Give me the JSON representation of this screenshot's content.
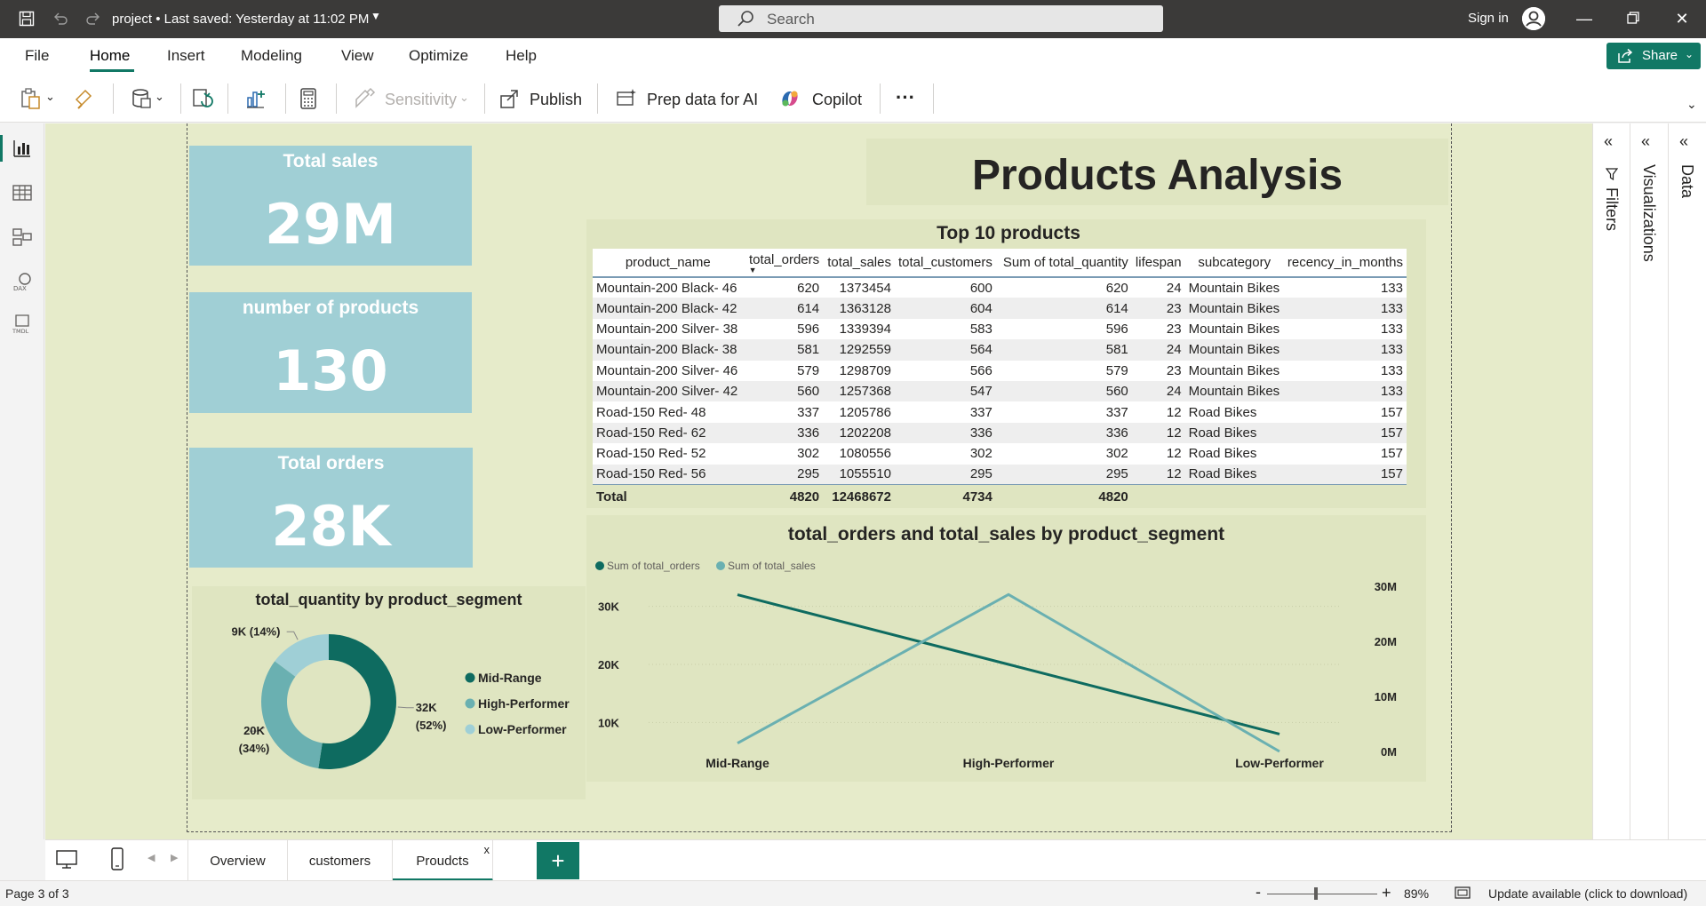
{
  "titlebar": {
    "file_title": "project • Last saved: Yesterday at 11:02 PM",
    "search_placeholder": "Search",
    "sign_in": "Sign in"
  },
  "menu": {
    "items": [
      "File",
      "Home",
      "Insert",
      "Modeling",
      "View",
      "Optimize",
      "Help"
    ],
    "active": "Home",
    "share": "Share"
  },
  "toolbar": {
    "sensitivity": "Sensitivity",
    "publish": "Publish",
    "prep_data": "Prep data for AI",
    "copilot": "Copilot",
    "more": "···"
  },
  "cards": {
    "total_sales": {
      "title": "Total sales",
      "value": "29M"
    },
    "num_products": {
      "title": "number of products",
      "value": "130"
    },
    "total_orders": {
      "title": "Total orders",
      "value": "28K"
    }
  },
  "report_title": "Products Analysis",
  "table": {
    "title": "Top 10 products",
    "columns": [
      "product_name",
      "total_orders",
      "total_sales",
      "total_customers",
      "Sum of total_quantity",
      "lifespan",
      "subcategory",
      "recency_in_months"
    ],
    "rows": [
      [
        "Mountain-200 Black- 46",
        "620",
        "1373454",
        "600",
        "620",
        "24",
        "Mountain Bikes",
        "133"
      ],
      [
        "Mountain-200 Black- 42",
        "614",
        "1363128",
        "604",
        "614",
        "23",
        "Mountain Bikes",
        "133"
      ],
      [
        "Mountain-200 Silver- 38",
        "596",
        "1339394",
        "583",
        "596",
        "23",
        "Mountain Bikes",
        "133"
      ],
      [
        "Mountain-200 Black- 38",
        "581",
        "1292559",
        "564",
        "581",
        "24",
        "Mountain Bikes",
        "133"
      ],
      [
        "Mountain-200 Silver- 46",
        "579",
        "1298709",
        "566",
        "579",
        "23",
        "Mountain Bikes",
        "133"
      ],
      [
        "Mountain-200 Silver- 42",
        "560",
        "1257368",
        "547",
        "560",
        "24",
        "Mountain Bikes",
        "133"
      ],
      [
        "Road-150 Red- 48",
        "337",
        "1205786",
        "337",
        "337",
        "12",
        "Road Bikes",
        "157"
      ],
      [
        "Road-150 Red- 62",
        "336",
        "1202208",
        "336",
        "336",
        "12",
        "Road Bikes",
        "157"
      ],
      [
        "Road-150 Red- 52",
        "302",
        "1080556",
        "302",
        "302",
        "12",
        "Road Bikes",
        "157"
      ],
      [
        "Road-150 Red- 56",
        "295",
        "1055510",
        "295",
        "295",
        "12",
        "Road Bikes",
        "157"
      ]
    ],
    "total": [
      "Total",
      "4820",
      "12468672",
      "4734",
      "4820",
      "",
      "",
      ""
    ]
  },
  "chart_data": [
    {
      "type": "pie",
      "title": "total_quantity by product_segment",
      "categories": [
        "Mid-Range",
        "High-Performer",
        "Low-Performer"
      ],
      "values": [
        32000,
        20000,
        9000
      ],
      "labels": [
        [
          "32K",
          "(52%)"
        ],
        [
          "20K",
          "(34%)"
        ],
        [
          "9K (14%)"
        ]
      ],
      "colors": [
        "#0e6b60",
        "#6ab0b1",
        "#9fcfd6"
      ],
      "legend_position": "right"
    },
    {
      "type": "line",
      "title": "total_orders and total_sales by product_segment",
      "categories": [
        "Mid-Range",
        "High-Performer",
        "Low-Performer"
      ],
      "series": [
        {
          "name": "Sum of total_orders",
          "values": [
            32000,
            20000,
            8000
          ],
          "axis": "left",
          "color": "#0e6b60"
        },
        {
          "name": "Sum of total_sales",
          "values": [
            1500000,
            28500000,
            0
          ],
          "axis": "right",
          "color": "#6ab0b1"
        }
      ],
      "y_left": {
        "ticks": [
          "30K",
          "20K",
          "10K"
        ],
        "tick_values": [
          30000,
          20000,
          10000
        ],
        "range": [
          5000,
          35000
        ]
      },
      "y_right": {
        "ticks": [
          "30M",
          "20M",
          "10M",
          "0M"
        ],
        "tick_values": [
          30000000,
          20000000,
          10000000,
          0
        ],
        "range": [
          0,
          30000000
        ]
      },
      "legend_position": "top-left"
    }
  ],
  "right_panes": {
    "filters": "Filters",
    "visualizations": "Visualizations",
    "data": "Data"
  },
  "pages": [
    "Overview",
    "customers",
    "Proudcts"
  ],
  "active_page": "Proudcts",
  "tab_close": "x",
  "status": {
    "page": "Page 3 of 3",
    "zoom": "89%",
    "update": "Update available (click to download)"
  }
}
